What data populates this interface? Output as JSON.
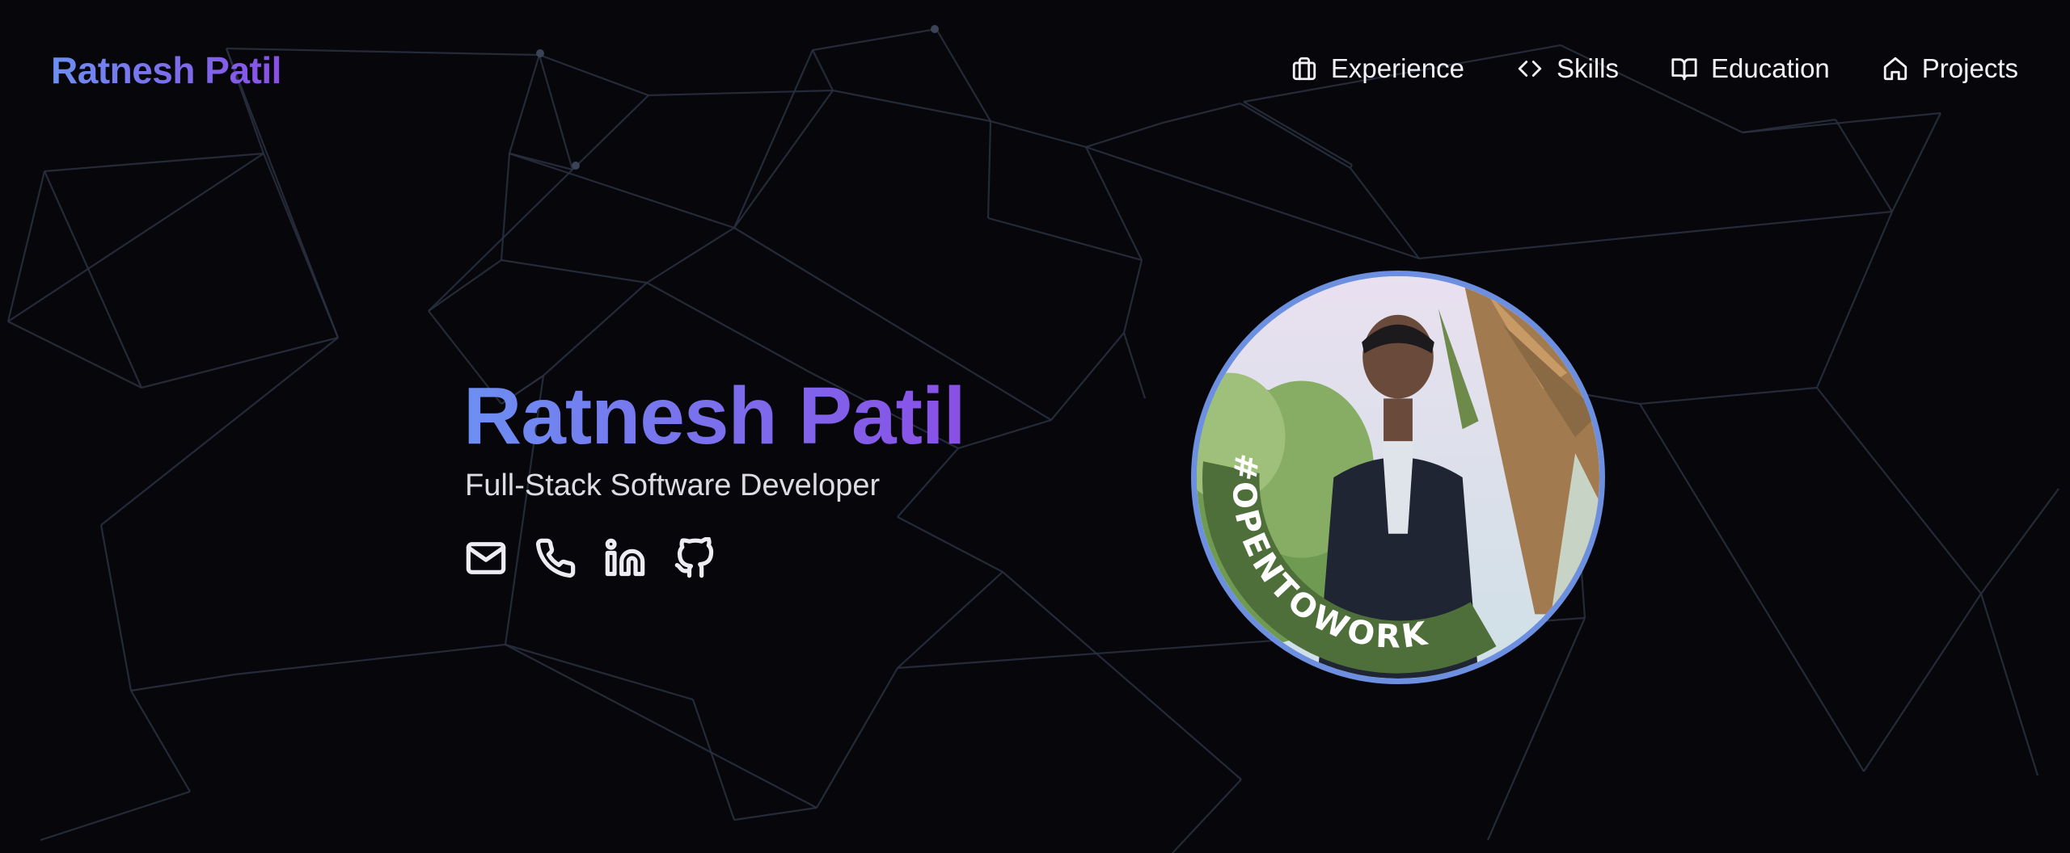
{
  "header": {
    "brand": "Ratnesh Patil",
    "nav": [
      {
        "label": "Experience",
        "icon": "briefcase-icon"
      },
      {
        "label": "Skills",
        "icon": "code-icon"
      },
      {
        "label": "Education",
        "icon": "book-open-icon"
      },
      {
        "label": "Projects",
        "icon": "home-icon"
      }
    ]
  },
  "hero": {
    "name": "Ratnesh Patil",
    "title": "Full-Stack Software Developer",
    "socials": [
      {
        "icon": "mail-icon"
      },
      {
        "icon": "phone-icon"
      },
      {
        "icon": "linkedin-icon"
      },
      {
        "icon": "github-icon"
      }
    ],
    "avatar": {
      "badge": "#OPENTOWORK",
      "ring_color": "#6d8fe0",
      "badge_color": "#4f6f3a"
    }
  },
  "theme": {
    "background": "#07070b",
    "gradient_start": "#6c8ff2",
    "gradient_end": "#8a4fe6",
    "network_line": "#2a3140"
  }
}
